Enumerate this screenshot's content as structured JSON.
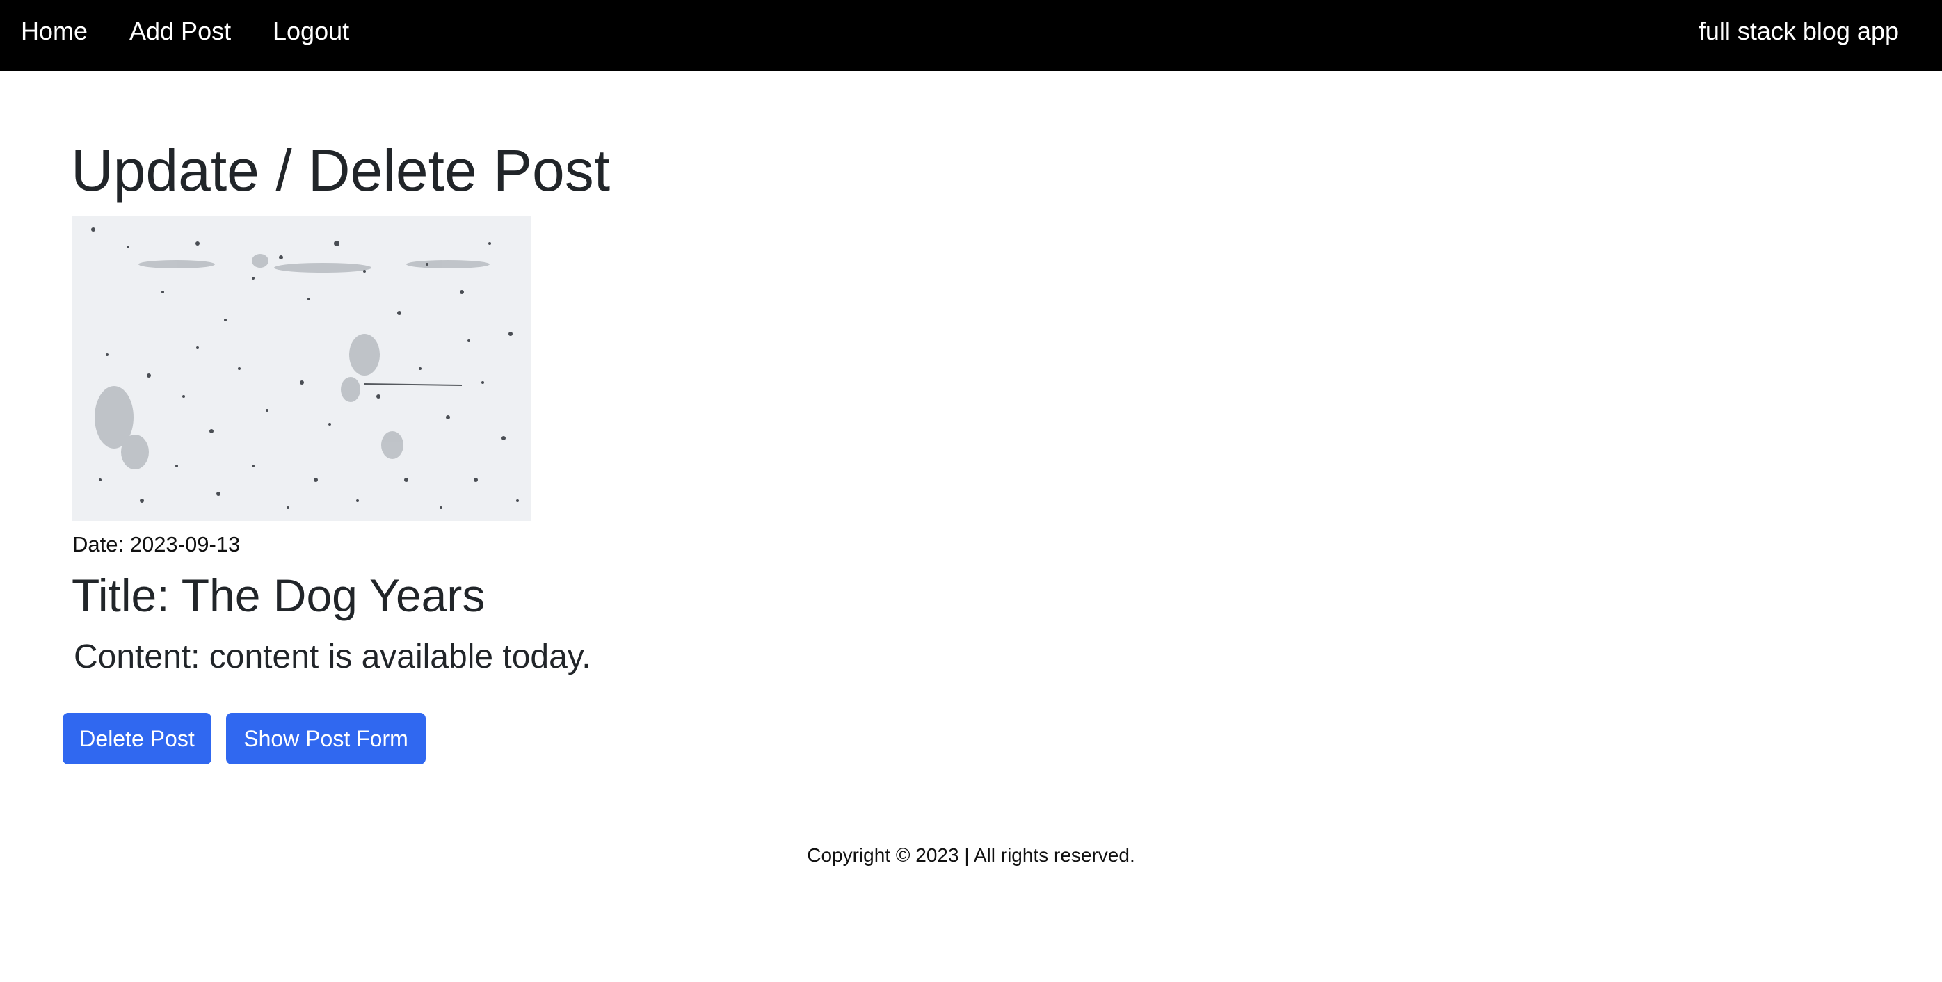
{
  "navbar": {
    "links": [
      {
        "label": "Home"
      },
      {
        "label": "Add Post"
      },
      {
        "label": "Logout"
      }
    ],
    "brand": "full stack blog app"
  },
  "page": {
    "title": "Update / Delete Post"
  },
  "post": {
    "date": "Date: 2023-09-13",
    "title": "Title: The Dog Years",
    "content": "Content: content is available today."
  },
  "actions": {
    "delete_label": "Delete Post",
    "show_form_label": "Show Post Form"
  },
  "footer": {
    "copyright": "Copyright © 2023 | All rights reserved."
  },
  "colors": {
    "navbar_bg": "#000000",
    "button_bg": "#3068f0",
    "text": "#212529"
  }
}
